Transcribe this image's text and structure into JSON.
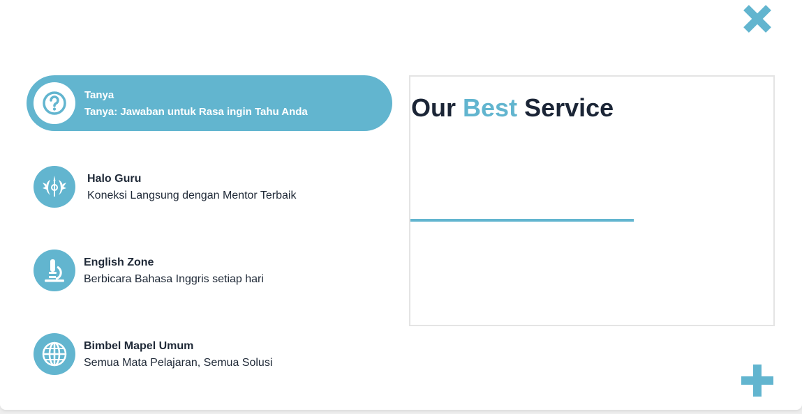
{
  "menu": [
    {
      "title": "Tanya",
      "description": "Tanya: Jawaban untuk Rasa ingin Tahu Anda",
      "icon": "question-icon",
      "active": true
    },
    {
      "title": "Halo Guru",
      "description": "Koneksi Langsung dengan Mentor Terbaik",
      "icon": "jedi-emblem-icon",
      "active": false
    },
    {
      "title": "English Zone",
      "description": "Berbicara Bahasa Inggris setiap hari",
      "icon": "microscope-icon",
      "active": false
    },
    {
      "title": "Bimbel Mapel Umum",
      "description": "Semua Mata Pelajaran, Semua Solusi",
      "icon": "globe-icon",
      "active": false
    }
  ],
  "service": {
    "title_part1": "Our",
    "title_accent": "Best",
    "title_part2": "Service"
  },
  "controls": {
    "close_icon": "close-icon",
    "add_icon": "plus-icon"
  },
  "colors": {
    "accent": "#62b5cf",
    "text": "#1f2937",
    "border": "#e4e4e4"
  }
}
